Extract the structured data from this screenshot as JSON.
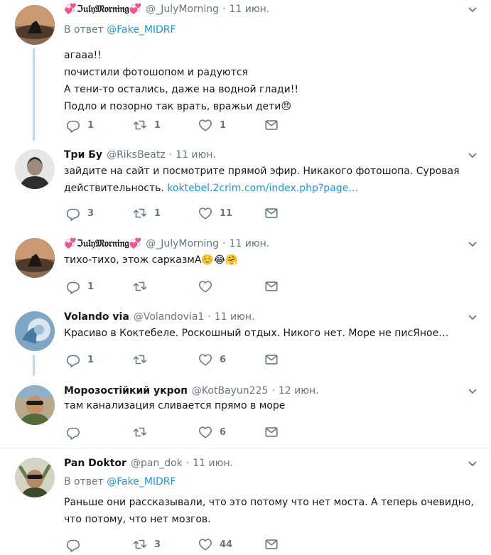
{
  "tweets": [
    {
      "name": "💞ℑ𝔲𝔩𝔶𝔐𝔬𝔯𝔫𝔦𝔫𝔤💞",
      "handle": "@_JulyMorning",
      "sep": "·",
      "time": "11 июн.",
      "reply_prefix": "В ответ",
      "reply_mention": "@Fake_MIDRF",
      "lines": [
        "агааа!!",
        "почистили фотошопом и радуются",
        "А тени-то остались, даже на водной глади!!",
        "Подло и позорно так врать, вражьи дети😠"
      ],
      "replies": "1",
      "retweets": "1",
      "likes": "1"
    },
    {
      "name": "Три Бу",
      "handle": "@RiksBeatz",
      "sep": "·",
      "time": "11 июн.",
      "lines": [
        "зайдите на сайт и посмотрите прямой эфир. Никакого фотошопа. Суровая"
      ],
      "line2_text": "действительность. ",
      "line2_link": "koktebel.2crim.com/index.php?page…",
      "replies": "3",
      "retweets": "1",
      "likes": "11"
    },
    {
      "name": "💞ℑ𝔲𝔩𝔶𝔐𝔬𝔯𝔫𝔦𝔫𝔤💞",
      "handle": "@_JulyMorning",
      "sep": "·",
      "time": "11 июн.",
      "lines": [
        "тихо-тихо, этож сарказмА☺️😂🤗"
      ],
      "replies": "1",
      "retweets": "",
      "likes": ""
    },
    {
      "name": "Volando via",
      "handle": "@Volandovia1",
      "sep": "·",
      "time": "11 июн.",
      "lines": [
        "Красиво в Коктебеле.  Роскошный отдых. Никого  нет. Море не писЯное…"
      ],
      "replies": "1",
      "retweets": "",
      "likes": "6"
    },
    {
      "name": "Морозостійкий укроп",
      "handle": "@KotBayun225",
      "sep": "·",
      "time": "12 июн.",
      "lines": [
        "там канализация сливается прямо в море"
      ],
      "replies": "",
      "retweets": "",
      "likes": "6"
    },
    {
      "name": "Pan Doktor",
      "handle": "@pan_dok",
      "sep": "·",
      "time": "11 июн.",
      "reply_prefix": "В ответ",
      "reply_mention": "@Fake_MIDRF",
      "lines": [
        "Раньше они рассказывали, что это потому что нет моста. А теперь очевидно,",
        "что потому, что нет мозгов."
      ],
      "replies": "",
      "retweets": "3",
      "likes": "44"
    }
  ],
  "icons": {
    "reply": "reply-icon",
    "retweet": "retweet-icon",
    "like": "heart-icon",
    "dm": "envelope-icon",
    "caret": "chevron-down-icon"
  },
  "colors": {
    "text": "#14171a",
    "secondary": "#657786",
    "link": "#1b95e0",
    "thread_line": "#c4d5e6",
    "divider": "#e6ecf0"
  }
}
